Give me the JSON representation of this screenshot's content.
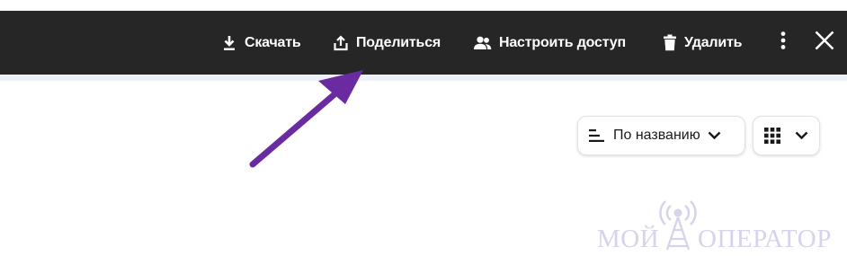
{
  "toolbar": {
    "actions": [
      {
        "label": "Скачать",
        "icon": "download-icon"
      },
      {
        "label": "Поделиться",
        "icon": "share-icon"
      },
      {
        "label": "Настроить доступ",
        "icon": "people-icon"
      },
      {
        "label": "Удалить",
        "icon": "trash-icon"
      }
    ],
    "more_icon": "more-vertical-icon",
    "close_icon": "close-icon",
    "background_color": "#262626",
    "text_color": "#ffffff"
  },
  "sort_dropdown": {
    "label": "По названию",
    "icon": "sort-lines-icon",
    "chevron_icon": "chevron-down-icon"
  },
  "view_dropdown": {
    "icon": "grid-view-icon",
    "chevron_icon": "chevron-down-icon"
  },
  "annotation": {
    "arrow_color": "#6a2ba0",
    "points_to": "share-button"
  },
  "watermark": {
    "text_left": "МОЙ",
    "text_right": "ОПЕРАТОР",
    "icon": "radio-tower-icon",
    "color": "#d6d3ea"
  }
}
